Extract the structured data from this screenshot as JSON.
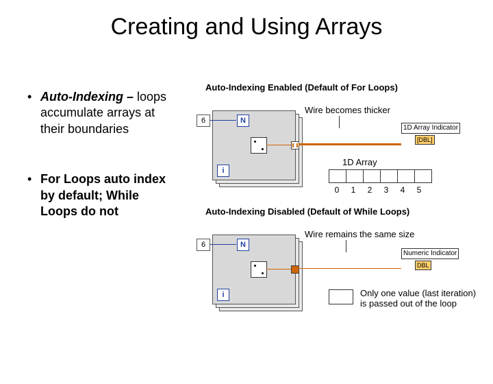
{
  "title": "Creating and Using Arrays",
  "bullets": [
    {
      "em": "Auto-Indexing –",
      "rest": " loops accumulate arrays at their boundaries"
    },
    {
      "em": "",
      "rest": "For Loops auto index by default; While Loops do not"
    }
  ],
  "top": {
    "caption": "Auto-Indexing Enabled (Default of For Loops)",
    "wire_note": "Wire becomes thicker",
    "indicator": "1D Array Indicator",
    "dbl": "[DBL]",
    "array_label": "1D Array",
    "iter_count": "6",
    "N": "N",
    "i": "i",
    "indices": [
      "0",
      "1",
      "2",
      "3",
      "4",
      "5"
    ]
  },
  "bottom": {
    "caption": "Auto-Indexing Disabled (Default of While Loops)",
    "wire_note": "Wire remains the same size",
    "indicator": "Numeric Indicator",
    "dbl": "DBL",
    "iter_count": "6",
    "N": "N",
    "i": "i",
    "note": "Only one value (last iteration) is passed out of the loop"
  }
}
